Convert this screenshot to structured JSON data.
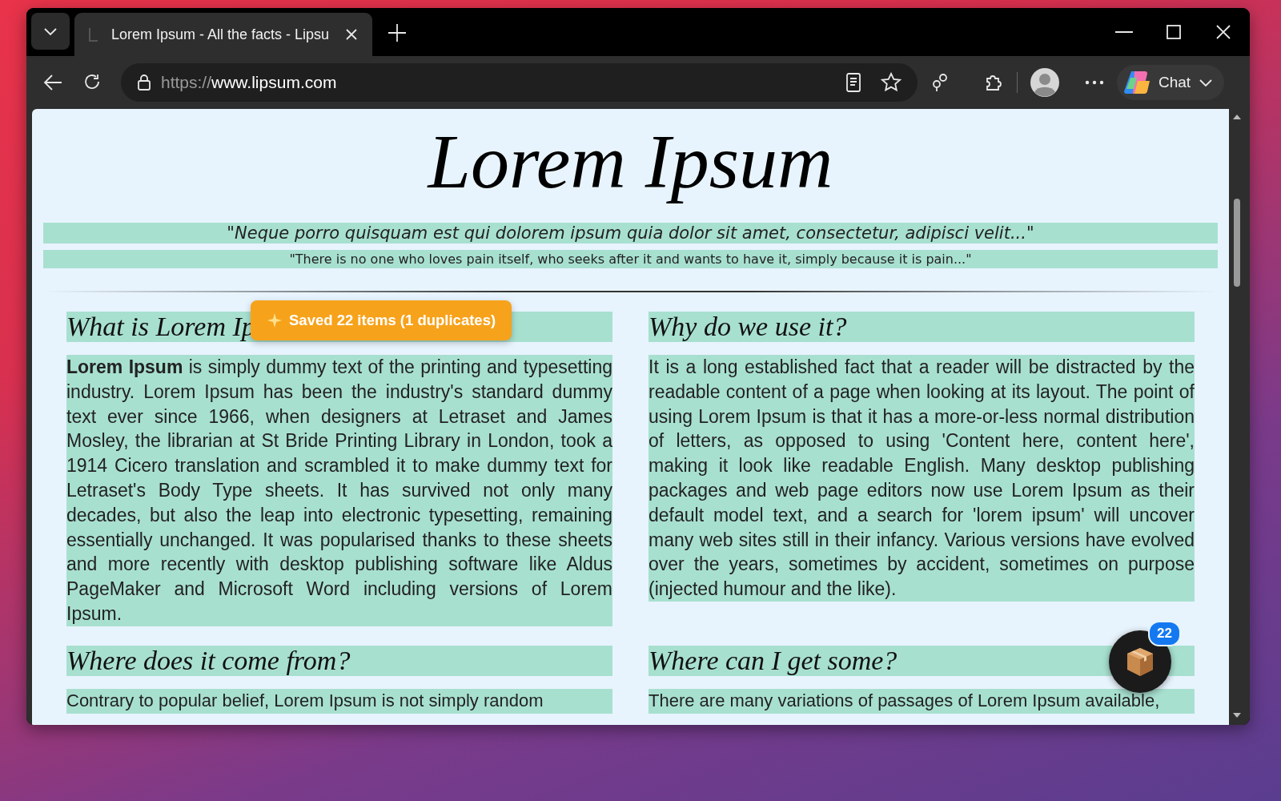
{
  "tab_strip": {
    "tab_title": "Lorem Ipsum - All the facts - Lipsu"
  },
  "address_bar": {
    "scheme": "https://",
    "host": "www.lipsum.com"
  },
  "toolbar": {
    "chat_label": "Chat"
  },
  "page": {
    "title": "Lorem Ipsum",
    "quotes": [
      "\"Neque porro quisquam est qui dolorem ipsum quia dolor sit amet, consectetur, adipisci velit...\"",
      "\"There is no one who loves pain itself, who seeks after it and wants to have it, simply because it is pain...\""
    ],
    "sections": [
      {
        "heading": "What is Lorem Ip",
        "paragraph": "**Lorem Ipsum** is simply dummy text of the printing and typesetting industry. Lorem Ipsum has been the industry's standard dummy text ever since 1966, when designers at Letraset and James Mosley, the librarian at St Bride Printing Library in London, took a 1914 Cicero translation and scrambled it to make dummy text for Letraset's Body Type sheets. It has survived not only many decades, but also the leap into electronic typesetting, remaining essentially unchanged. It was popularised thanks to these sheets and more recently with desktop publishing software like Aldus PageMaker and Microsoft Word including versions of Lorem Ipsum."
      },
      {
        "heading": "Why do we use it?",
        "paragraph": "It is a long established fact that a reader will be distracted by the readable content of a page when looking at its layout. The point of using Lorem Ipsum is that it has a more-or-less normal distribution of letters, as opposed to using 'Content here, content here', making it look like readable English. Many desktop publishing packages and web page editors now use Lorem Ipsum as their default model text, and a search for 'lorem ipsum' will uncover many web sites still in their infancy. Various versions have evolved over the years, sometimes by accident, sometimes on purpose (injected humour and the like)."
      },
      {
        "heading": "Where does it come from?",
        "paragraph": "Contrary to popular belief, Lorem Ipsum is not simply random"
      },
      {
        "heading": "Where can I get some?",
        "paragraph": "There are many variations of passages of Lorem Ipsum available,"
      }
    ]
  },
  "toast": {
    "text": "Saved 22 items (1 duplicates)"
  },
  "floating_button": {
    "badge": "22"
  }
}
